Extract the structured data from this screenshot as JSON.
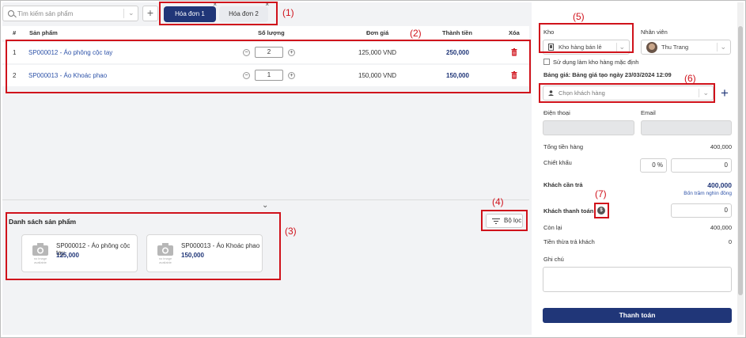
{
  "search": {
    "placeholder": "Tìm kiếm sản phẩm"
  },
  "tabs": [
    {
      "label": "Hóa đơn 1",
      "active": true
    },
    {
      "label": "Hóa đơn 2",
      "active": false
    }
  ],
  "annotations": [
    "(1)",
    "(2)",
    "(3)",
    "(4)",
    "(5)",
    "(6)",
    "(7)"
  ],
  "table": {
    "headers": [
      "#",
      "Sản phẩm",
      "Số lượng",
      "Đơn giá",
      "Thành tiền",
      "Xóa"
    ],
    "rows": [
      {
        "index": "1",
        "product": "SP000012 - Áo phông cộc tay",
        "qty": "2",
        "price": "125,000 VND",
        "total": "250,000"
      },
      {
        "index": "2",
        "product": "SP000013 - Áo Khoác phao",
        "qty": "1",
        "price": "150,000 VND",
        "total": "150,000"
      }
    ]
  },
  "product_list": {
    "title": "Danh sách sản phẩm",
    "filter_label": "Bộ lọc",
    "no_image": "no image available",
    "items": [
      {
        "name": "SP000012 - Áo phông cộc tay",
        "price": "125,000"
      },
      {
        "name": "SP000013 - Áo Khoác phao",
        "price": "150,000"
      }
    ]
  },
  "sidebar": {
    "warehouse_label": "Kho",
    "warehouse_value": "Kho hàng bán lẻ",
    "staff_label": "Nhân viên",
    "staff_value": "Thu Trang",
    "default_warehouse_label": "Sử dụng làm kho hàng mặc định",
    "price_list": "Bảng giá: Bảng giá tạo ngày 23/03/2024 12:09",
    "customer_placeholder": "Chọn khách hàng",
    "phone_label": "Điện thoại",
    "email_label": "Email",
    "total_label": "Tổng tiền hàng",
    "total_value": "400,000",
    "discount_label": "Chiết khấu",
    "discount_percent": "0 %",
    "discount_value": "0",
    "customer_due_label": "Khách cần trả",
    "customer_due_value": "400,000",
    "customer_due_words": "Bốn trăm nghìn đồng",
    "customer_paid_label": "Khách thanh toán",
    "customer_paid_value": "0",
    "remaining_label": "Còn lại",
    "remaining_value": "400,000",
    "change_label": "Tiền thừa trả khách",
    "change_value": "0",
    "note_label": "Ghi chú",
    "pay_button": "Thanh toán"
  },
  "colors": {
    "primary": "#203678",
    "annotation": "#d0121b",
    "link": "#2d52a8",
    "delete": "#d0121b"
  }
}
